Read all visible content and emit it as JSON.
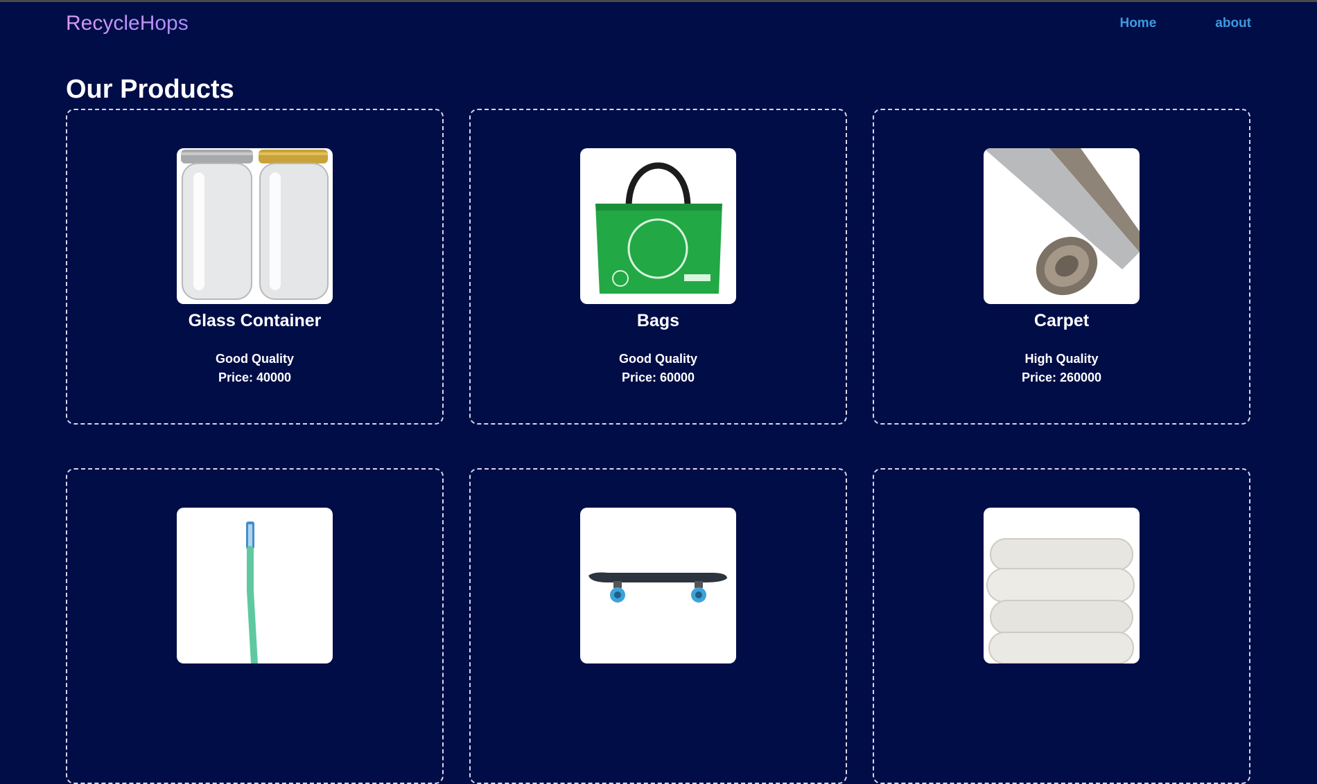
{
  "header": {
    "brand": "RecycleHops",
    "nav": [
      "Home",
      "about"
    ]
  },
  "main": {
    "title": "Our Products",
    "products": [
      {
        "name": "Glass Container",
        "quality": "Good Quality",
        "price": "Price: 40000",
        "image": "glass-jars-image"
      },
      {
        "name": "Bags",
        "quality": "Good Quality",
        "price": "Price: 60000",
        "image": "reusable-bag-image"
      },
      {
        "name": "Carpet",
        "quality": "High Quality",
        "price": "Price: 260000",
        "image": "rolled-carpet-image"
      },
      {
        "name": "",
        "quality": "",
        "price": "",
        "image": "toothbrush-image"
      },
      {
        "name": "",
        "quality": "",
        "price": "",
        "image": "skateboard-image"
      },
      {
        "name": "",
        "quality": "",
        "price": "",
        "image": "folded-blanket-image"
      }
    ]
  },
  "colors": {
    "background": "#000d47",
    "brand": "#c795f5",
    "nav_link": "#3c9ae0"
  }
}
